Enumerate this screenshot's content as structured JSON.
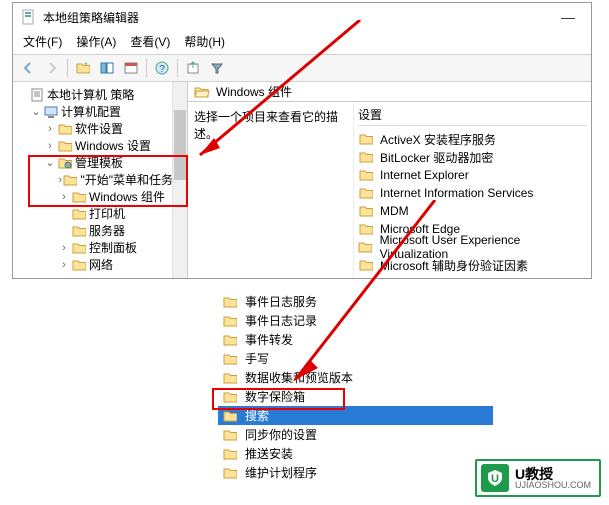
{
  "window": {
    "title": "本地组策略编辑器",
    "minimize_glyph": "—"
  },
  "menubar": {
    "file": "文件(F)",
    "action": "操作(A)",
    "view": "查看(V)",
    "help": "帮助(H)"
  },
  "tree": {
    "root": "本地计算机 策略",
    "computer_config": "计算机配置",
    "software_settings": "软件设置",
    "windows_settings": "Windows 设置",
    "admin_templates": "管理模板",
    "start_menu": "\"开始\"菜单和任务栏",
    "windows_components": "Windows 组件",
    "printers": "打印机",
    "server": "服务器",
    "control_panel": "控制面板",
    "network": "网络"
  },
  "right": {
    "header": "Windows 组件",
    "desc": "选择一个项目来查看它的描述。",
    "settings_header": "设置",
    "items": [
      "ActiveX 安装程序服务",
      "BitLocker 驱动器加密",
      "Internet Explorer",
      "Internet Information Services",
      "MDM",
      "Microsoft Edge",
      "Microsoft User Experience Virtualization",
      "Microsoft 辅助身份验证因素"
    ]
  },
  "lower": {
    "items": [
      "事件日志服务",
      "事件日志记录",
      "事件转发",
      "手写",
      "数据收集和预览版本",
      "数字保险箱",
      "搜索",
      "同步你的设置",
      "推送安装",
      "维护计划程序"
    ],
    "selected_index": 6
  },
  "watermark": {
    "name": "U教授",
    "url": "UJIAOSHOU.COM"
  }
}
